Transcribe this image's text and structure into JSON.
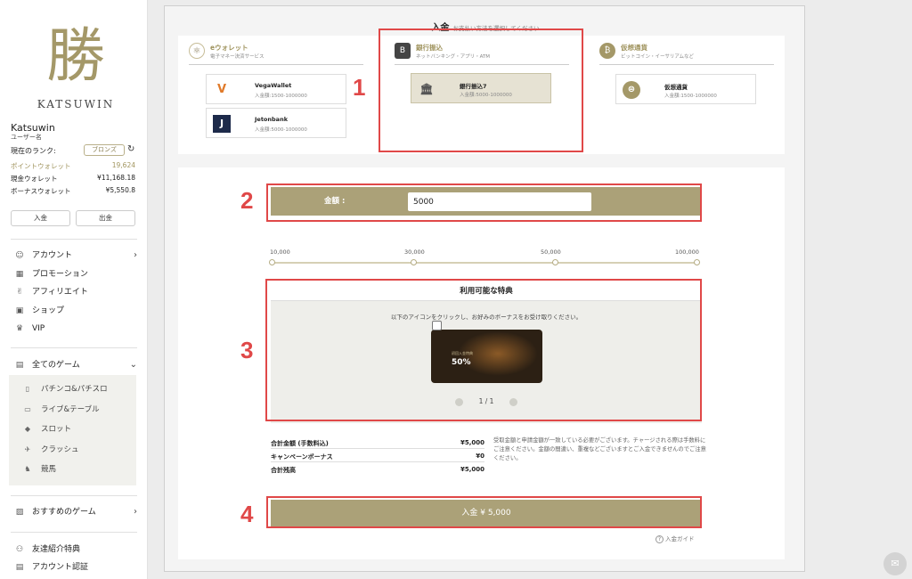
{
  "sidebar": {
    "logo_glyph": "勝",
    "logo_text": "KATSUWIN",
    "user_name": "Katsuwin",
    "user_sub": "ユーザー名",
    "rank_label": "現在のランク:",
    "rank_value": "ブロンズ",
    "refresh_icon": "↻",
    "wallets": [
      {
        "label": "ポイントウォレット",
        "value": "19,624"
      },
      {
        "label": "現金ウォレット",
        "value": "¥11,168.18"
      },
      {
        "label": "ボーナスウォレット",
        "value": "¥5,550.8"
      }
    ],
    "deposit_label": "入金",
    "withdraw_label": "出金",
    "nav": [
      {
        "label": "アカウント",
        "icon": "☺",
        "chevron": "›"
      },
      {
        "label": "プロモーション",
        "icon": "▦"
      },
      {
        "label": "アフィリエイト",
        "icon": "✌"
      },
      {
        "label": "ショップ",
        "icon": "▣"
      },
      {
        "label": "VIP",
        "icon": "♛"
      }
    ],
    "games_header": {
      "label": "全てのゲーム",
      "icon": "▤",
      "chevron": "⌄"
    },
    "games": [
      {
        "label": "パチンコ&パチスロ",
        "icon": "▯"
      },
      {
        "label": "ライブ&テーブル",
        "icon": "▭"
      },
      {
        "label": "スロット",
        "icon": "◆"
      },
      {
        "label": "クラッシュ",
        "icon": "✈"
      },
      {
        "label": "競馬",
        "icon": "♞"
      }
    ],
    "recommended": {
      "label": "おすすめのゲーム",
      "icon": "▨",
      "chevron": "›"
    },
    "bottom_nav": [
      {
        "label": "友達紹介特典",
        "icon": "⚇"
      },
      {
        "label": "アカウント認証",
        "icon": "▤"
      }
    ]
  },
  "main": {
    "title": "入金",
    "title_sub": "お支払い方法を選択してください",
    "categories": [
      {
        "title": "eウォレット",
        "sub": "電子マネー決済サービス",
        "icon": "⚛"
      },
      {
        "title": "銀行振込",
        "sub": "ネットバンキング・アプリ・ATM",
        "icon": "B"
      },
      {
        "title": "仮想通貨",
        "sub": "ビットコイン・イーサリアムなど",
        "icon": "₿"
      }
    ],
    "methods": {
      "vega": {
        "name": "VegaWallet",
        "range": "入金額:1500-1000000",
        "icon": "V"
      },
      "jeton": {
        "name": "Jetonbank",
        "range": "入金額:5000-1000000",
        "icon": "J"
      },
      "bank": {
        "name": "銀行振込7",
        "range": "入金額:5000-1000000",
        "icon": "🏛"
      },
      "crypto": {
        "name": "仮想通貨",
        "range": "入金額:1500-1000000",
        "icon": "⊜"
      }
    },
    "amount_label": "金額 :",
    "amount_value": "5000",
    "scale": [
      "10,000",
      "30,000",
      "50,000",
      "100,000"
    ],
    "benefit_title": "利用可能な特典",
    "benefit_note": "以下のアイコンをクリックし、お好みのボーナスをお受け取りください。",
    "banner_small": "初回入金特典",
    "banner_pct": "50%",
    "pager": "1 / 1",
    "summary": [
      {
        "label": "合計金額 (手数料込)",
        "value": "¥5,000"
      },
      {
        "label": "キャンペーンボーナス",
        "value": "¥0"
      },
      {
        "label": "合計残高",
        "value": "¥5,000"
      }
    ],
    "summary_note": "受取金額と申請金額が一致している必要がございます。チャージされる際は手数料にご注意ください。金額の間違い、重複などございますとご入金できませんのでご注意ください。",
    "submit_label": "入金 ¥ 5,000",
    "guide_label": "入金ガイド"
  },
  "annotations": [
    "1",
    "2",
    "3",
    "4"
  ],
  "colors": {
    "accent": "#aba178",
    "highlight": "#e04848"
  }
}
